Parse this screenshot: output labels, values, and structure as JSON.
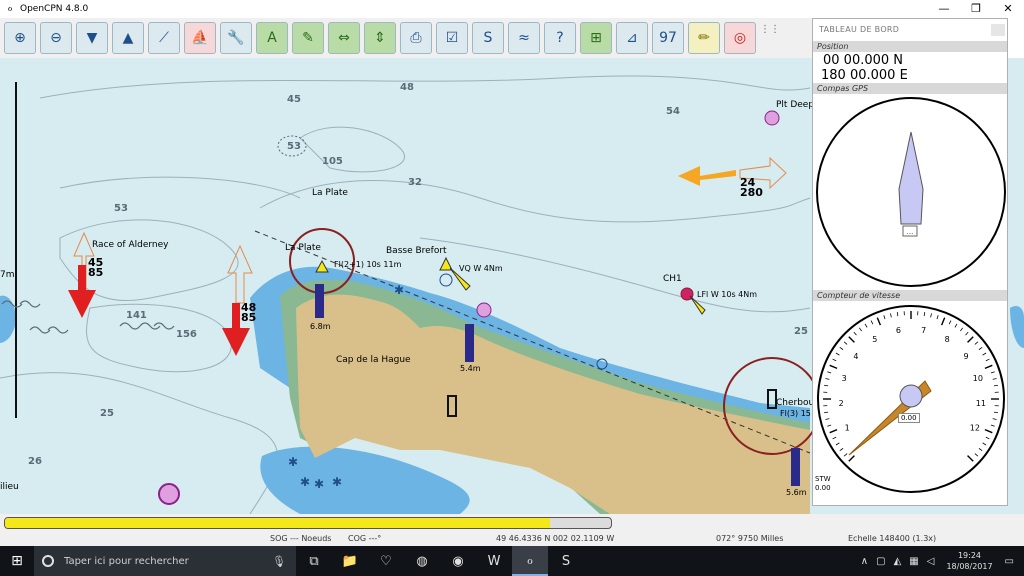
{
  "window": {
    "title": "OpenCPN 4.8.0",
    "minimize": "—",
    "maximize": "❐",
    "close": "✕"
  },
  "toolbar": {
    "buttons": [
      {
        "name": "zoom-in-button",
        "icon": "zoom-in-icon",
        "glyph": "⊕"
      },
      {
        "name": "zoom-out-button",
        "icon": "zoom-out-icon",
        "glyph": "⊖"
      },
      {
        "name": "scale-down-button",
        "icon": "scale-down-icon",
        "glyph": "▼"
      },
      {
        "name": "scale-up-button",
        "icon": "scale-up-icon",
        "glyph": "▲"
      },
      {
        "name": "route-button",
        "icon": "route-icon",
        "glyph": "⟋"
      },
      {
        "name": "ship-button",
        "icon": "ship-icon",
        "glyph": "⛵"
      },
      {
        "name": "settings-button",
        "icon": "wrench-icon",
        "glyph": "🔧"
      },
      {
        "name": "text-button",
        "icon": "text-icon",
        "glyph": "A"
      },
      {
        "name": "lights-button",
        "icon": "light-icon",
        "glyph": "✎"
      },
      {
        "name": "pan-left-right-button",
        "icon": "arrows-horizontal-icon",
        "glyph": "⇔"
      },
      {
        "name": "pan-up-down-button",
        "icon": "arrows-vertical-icon",
        "glyph": "⇕"
      },
      {
        "name": "print-button",
        "icon": "print-icon",
        "glyph": "⎙"
      },
      {
        "name": "route-manager-button",
        "icon": "checklist-icon",
        "glyph": "☑"
      },
      {
        "name": "track-button",
        "icon": "track-icon",
        "glyph": "S"
      },
      {
        "name": "depth-button",
        "icon": "depth-icon",
        "glyph": "≈"
      },
      {
        "name": "help-button",
        "icon": "help-icon",
        "glyph": "?"
      },
      {
        "name": "ais-button",
        "icon": "ais-icon",
        "glyph": "⊞"
      },
      {
        "name": "tide-button",
        "icon": "tide-icon",
        "glyph": "⊿"
      },
      {
        "name": "current-button",
        "icon": "current-icon",
        "glyph": "97"
      },
      {
        "name": "mark-button",
        "icon": "pencil-icon",
        "glyph": "✏"
      },
      {
        "name": "mob-button",
        "icon": "lifebuoy-icon",
        "glyph": "◎"
      }
    ]
  },
  "chart": {
    "depths": [
      {
        "v": "45"
      },
      {
        "v": "48"
      },
      {
        "v": "54"
      },
      {
        "v": "53"
      },
      {
        "v": "105"
      },
      {
        "v": "32"
      },
      {
        "v": "53"
      },
      {
        "v": "141"
      },
      {
        "v": "156"
      },
      {
        "v": "25"
      },
      {
        "v": "26"
      },
      {
        "v": "25"
      }
    ],
    "places": {
      "la_plate_1": "La Plate",
      "la_plate_2": "La Plate",
      "race_alderney": "Race of Alderney",
      "basse_brefort": "Basse Brefort",
      "cap_hague": "Cap de la Hague",
      "plt_deep": "Plt Deep",
      "ch1": "CH1",
      "cherbourg": "Cherbou",
      "left_depth": "7m",
      "left_bottom": "ilieu"
    },
    "lights": {
      "la_plate_light": "Fl(2+1) 10s 11m",
      "vq": "VQ W 4Nm",
      "lfl": "LFl W 10s 4Nm",
      "cherbourg_light": "Fl(3) 15"
    },
    "tide_values": [
      {
        "top": "45",
        "bottom": "85"
      },
      {
        "top": "48",
        "bottom": "85"
      },
      {
        "top": "24",
        "bottom": "280"
      }
    ],
    "depth_bars": [
      "6.8m",
      "5.4m",
      "5.6m"
    ]
  },
  "dashboard": {
    "title": "TABLEAU DE BORD",
    "position_header": "Position",
    "lat": "00 00.000 N",
    "lon": "180 00.000 E",
    "compass_header": "Compas GPS",
    "speed_header": "Compteur de vitesse",
    "speed_value": "0.00",
    "speed_unit_label": "STW",
    "speed_bottom_value": "0.00",
    "ticks": [
      "1",
      "2",
      "3",
      "4",
      "5",
      "6",
      "7",
      "8",
      "9",
      "10",
      "11",
      "12"
    ]
  },
  "status": {
    "progress": 0.9,
    "sog": "SOG --- Noeuds",
    "cog": "COG ---°",
    "position": "49 46.4336 N   002 02.1109 W",
    "bearing": "072°  9750 Milles",
    "scale": "Echelle 148400 (1.3x)"
  },
  "taskbar": {
    "search_placeholder": "Taper ici pour rechercher",
    "time": "19:24",
    "date": "18/08/2017"
  },
  "colors": {
    "sea": "#d6ecf0",
    "shallow": "#6cb4e4",
    "land": "#d9c08a",
    "coast": "#8ab892",
    "accent_arrow": "#e02020",
    "tide_arrow": "#f5a623",
    "progress": "#f5e81a"
  }
}
